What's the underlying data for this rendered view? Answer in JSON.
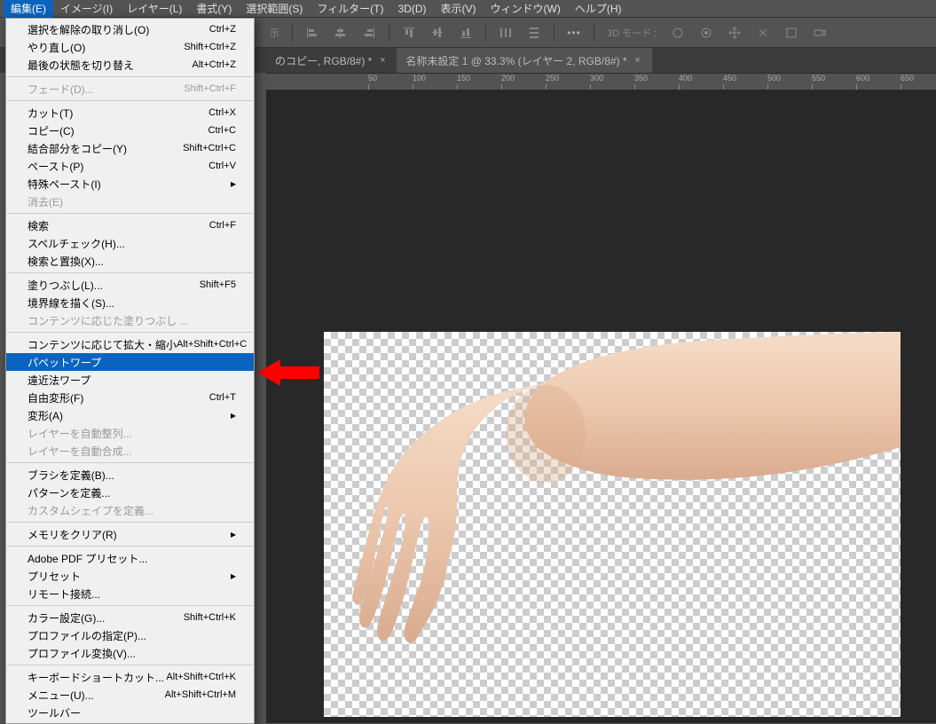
{
  "menubar": {
    "items": [
      "編集(E)",
      "イメージ(I)",
      "レイヤー(L)",
      "書式(Y)",
      "選択範囲(S)",
      "フィルター(T)",
      "3D(D)",
      "表示(V)",
      "ウィンドウ(W)",
      "ヘルプ(H)"
    ]
  },
  "toolbar": {
    "mode3d": "3D モード :"
  },
  "tabs": {
    "t0_suffix": "のコピー, RGB/8#) *",
    "t1": "名称未設定 1 @ 33.3% (レイヤー 2, RGB/8#) *"
  },
  "ruler_label_behind": "示",
  "ruler": [
    "50",
    "100",
    "150",
    "200",
    "250",
    "300",
    "350",
    "400",
    "450",
    "500",
    "550",
    "600",
    "650"
  ],
  "dropdown": [
    {
      "label": "選択を解除の取り消し(O)",
      "sc": "Ctrl+Z"
    },
    {
      "label": "やり直し(O)",
      "sc": "Shift+Ctrl+Z"
    },
    {
      "label": "最後の状態を切り替え",
      "sc": "Alt+Ctrl+Z"
    },
    {
      "sep": true
    },
    {
      "label": "フェード(D)...",
      "sc": "Shift+Ctrl+F",
      "dis": true
    },
    {
      "sep": true
    },
    {
      "label": "カット(T)",
      "sc": "Ctrl+X"
    },
    {
      "label": "コピー(C)",
      "sc": "Ctrl+C"
    },
    {
      "label": "結合部分をコピー(Y)",
      "sc": "Shift+Ctrl+C"
    },
    {
      "label": "ペースト(P)",
      "sc": "Ctrl+V"
    },
    {
      "label": "特殊ペースト(I)",
      "sub": true
    },
    {
      "label": "消去(E)",
      "dis": true
    },
    {
      "sep": true
    },
    {
      "label": "検索",
      "sc": "Ctrl+F"
    },
    {
      "label": "スペルチェック(H)..."
    },
    {
      "label": "検索と置換(X)..."
    },
    {
      "sep": true
    },
    {
      "label": "塗りつぶし(L)...",
      "sc": "Shift+F5"
    },
    {
      "label": "境界線を描く(S)..."
    },
    {
      "label": "コンテンツに応じた塗りつぶし ...",
      "dis": true
    },
    {
      "sep": true
    },
    {
      "label": "コンテンツに応じて拡大・縮小",
      "sc": "Alt+Shift+Ctrl+C"
    },
    {
      "label": "パペットワープ",
      "hl": true
    },
    {
      "label": "遠近法ワープ"
    },
    {
      "label": "自由変形(F)",
      "sc": "Ctrl+T"
    },
    {
      "label": "変形(A)",
      "sub": true
    },
    {
      "label": "レイヤーを自動整列...",
      "dis": true
    },
    {
      "label": "レイヤーを自動合成...",
      "dis": true
    },
    {
      "sep": true
    },
    {
      "label": "ブラシを定義(B)..."
    },
    {
      "label": "パターンを定義..."
    },
    {
      "label": "カスタムシェイプを定義...",
      "dis": true
    },
    {
      "sep": true
    },
    {
      "label": "メモリをクリア(R)",
      "sub": true
    },
    {
      "sep": true
    },
    {
      "label": "Adobe PDF プリセット..."
    },
    {
      "label": "プリセット",
      "sub": true
    },
    {
      "label": "リモート接続..."
    },
    {
      "sep": true
    },
    {
      "label": "カラー設定(G)...",
      "sc": "Shift+Ctrl+K"
    },
    {
      "label": "プロファイルの指定(P)..."
    },
    {
      "label": "プロファイル変換(V)..."
    },
    {
      "sep": true
    },
    {
      "label": "キーボードショートカット...",
      "sc": "Alt+Shift+Ctrl+K"
    },
    {
      "label": "メニュー(U)...",
      "sc": "Alt+Shift+Ctrl+M"
    },
    {
      "label": "ツールバー"
    }
  ]
}
